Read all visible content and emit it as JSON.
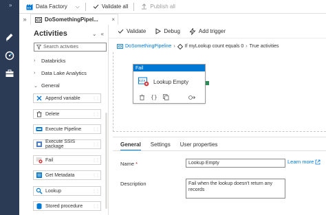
{
  "rail": {
    "collapse_glyph": "»",
    "icons": [
      "pencil-icon",
      "monitor-icon",
      "toolbox-icon"
    ]
  },
  "topbar": {
    "factory_label": "Data Factory",
    "validate_all_label": "Validate all",
    "publish_all_label": "Publish all"
  },
  "tabstrip": {
    "tab_label": "DoSomethingPipel..."
  },
  "activities": {
    "title": "Activities",
    "search_placeholder": "Search activities",
    "categories": [
      "Databricks",
      "Data Lake Analytics",
      "General"
    ],
    "items": [
      "Append variable",
      "Delete",
      "Execute Pipeline",
      "Execute SSIS package",
      "Fail",
      "Get Metadata",
      "Lookup",
      "Stored procedure"
    ]
  },
  "canvas_toolbar": {
    "validate_label": "Validate",
    "debug_label": "Debug",
    "add_trigger_label": "Add trigger"
  },
  "breadcrumb": {
    "pipeline": "DoSomethingPipeline",
    "condition": "If myLookup count equals 0",
    "branch": "True activities"
  },
  "node": {
    "type_label": "Fail",
    "name": "Lookup Empty"
  },
  "properties": {
    "tabs": [
      "General",
      "Settings",
      "User properties"
    ],
    "name_label": "Name",
    "required_marker": "*",
    "name_value": "Lookup Empty",
    "learn_more_label": "Learn more",
    "description_label": "Description",
    "description_value": "Fail when the lookup doesn't return any records"
  },
  "colors": {
    "accent": "#0078d4",
    "rail": "#2b3a55",
    "fail_red": "#d13438",
    "connector_green": "#2e8b57"
  }
}
